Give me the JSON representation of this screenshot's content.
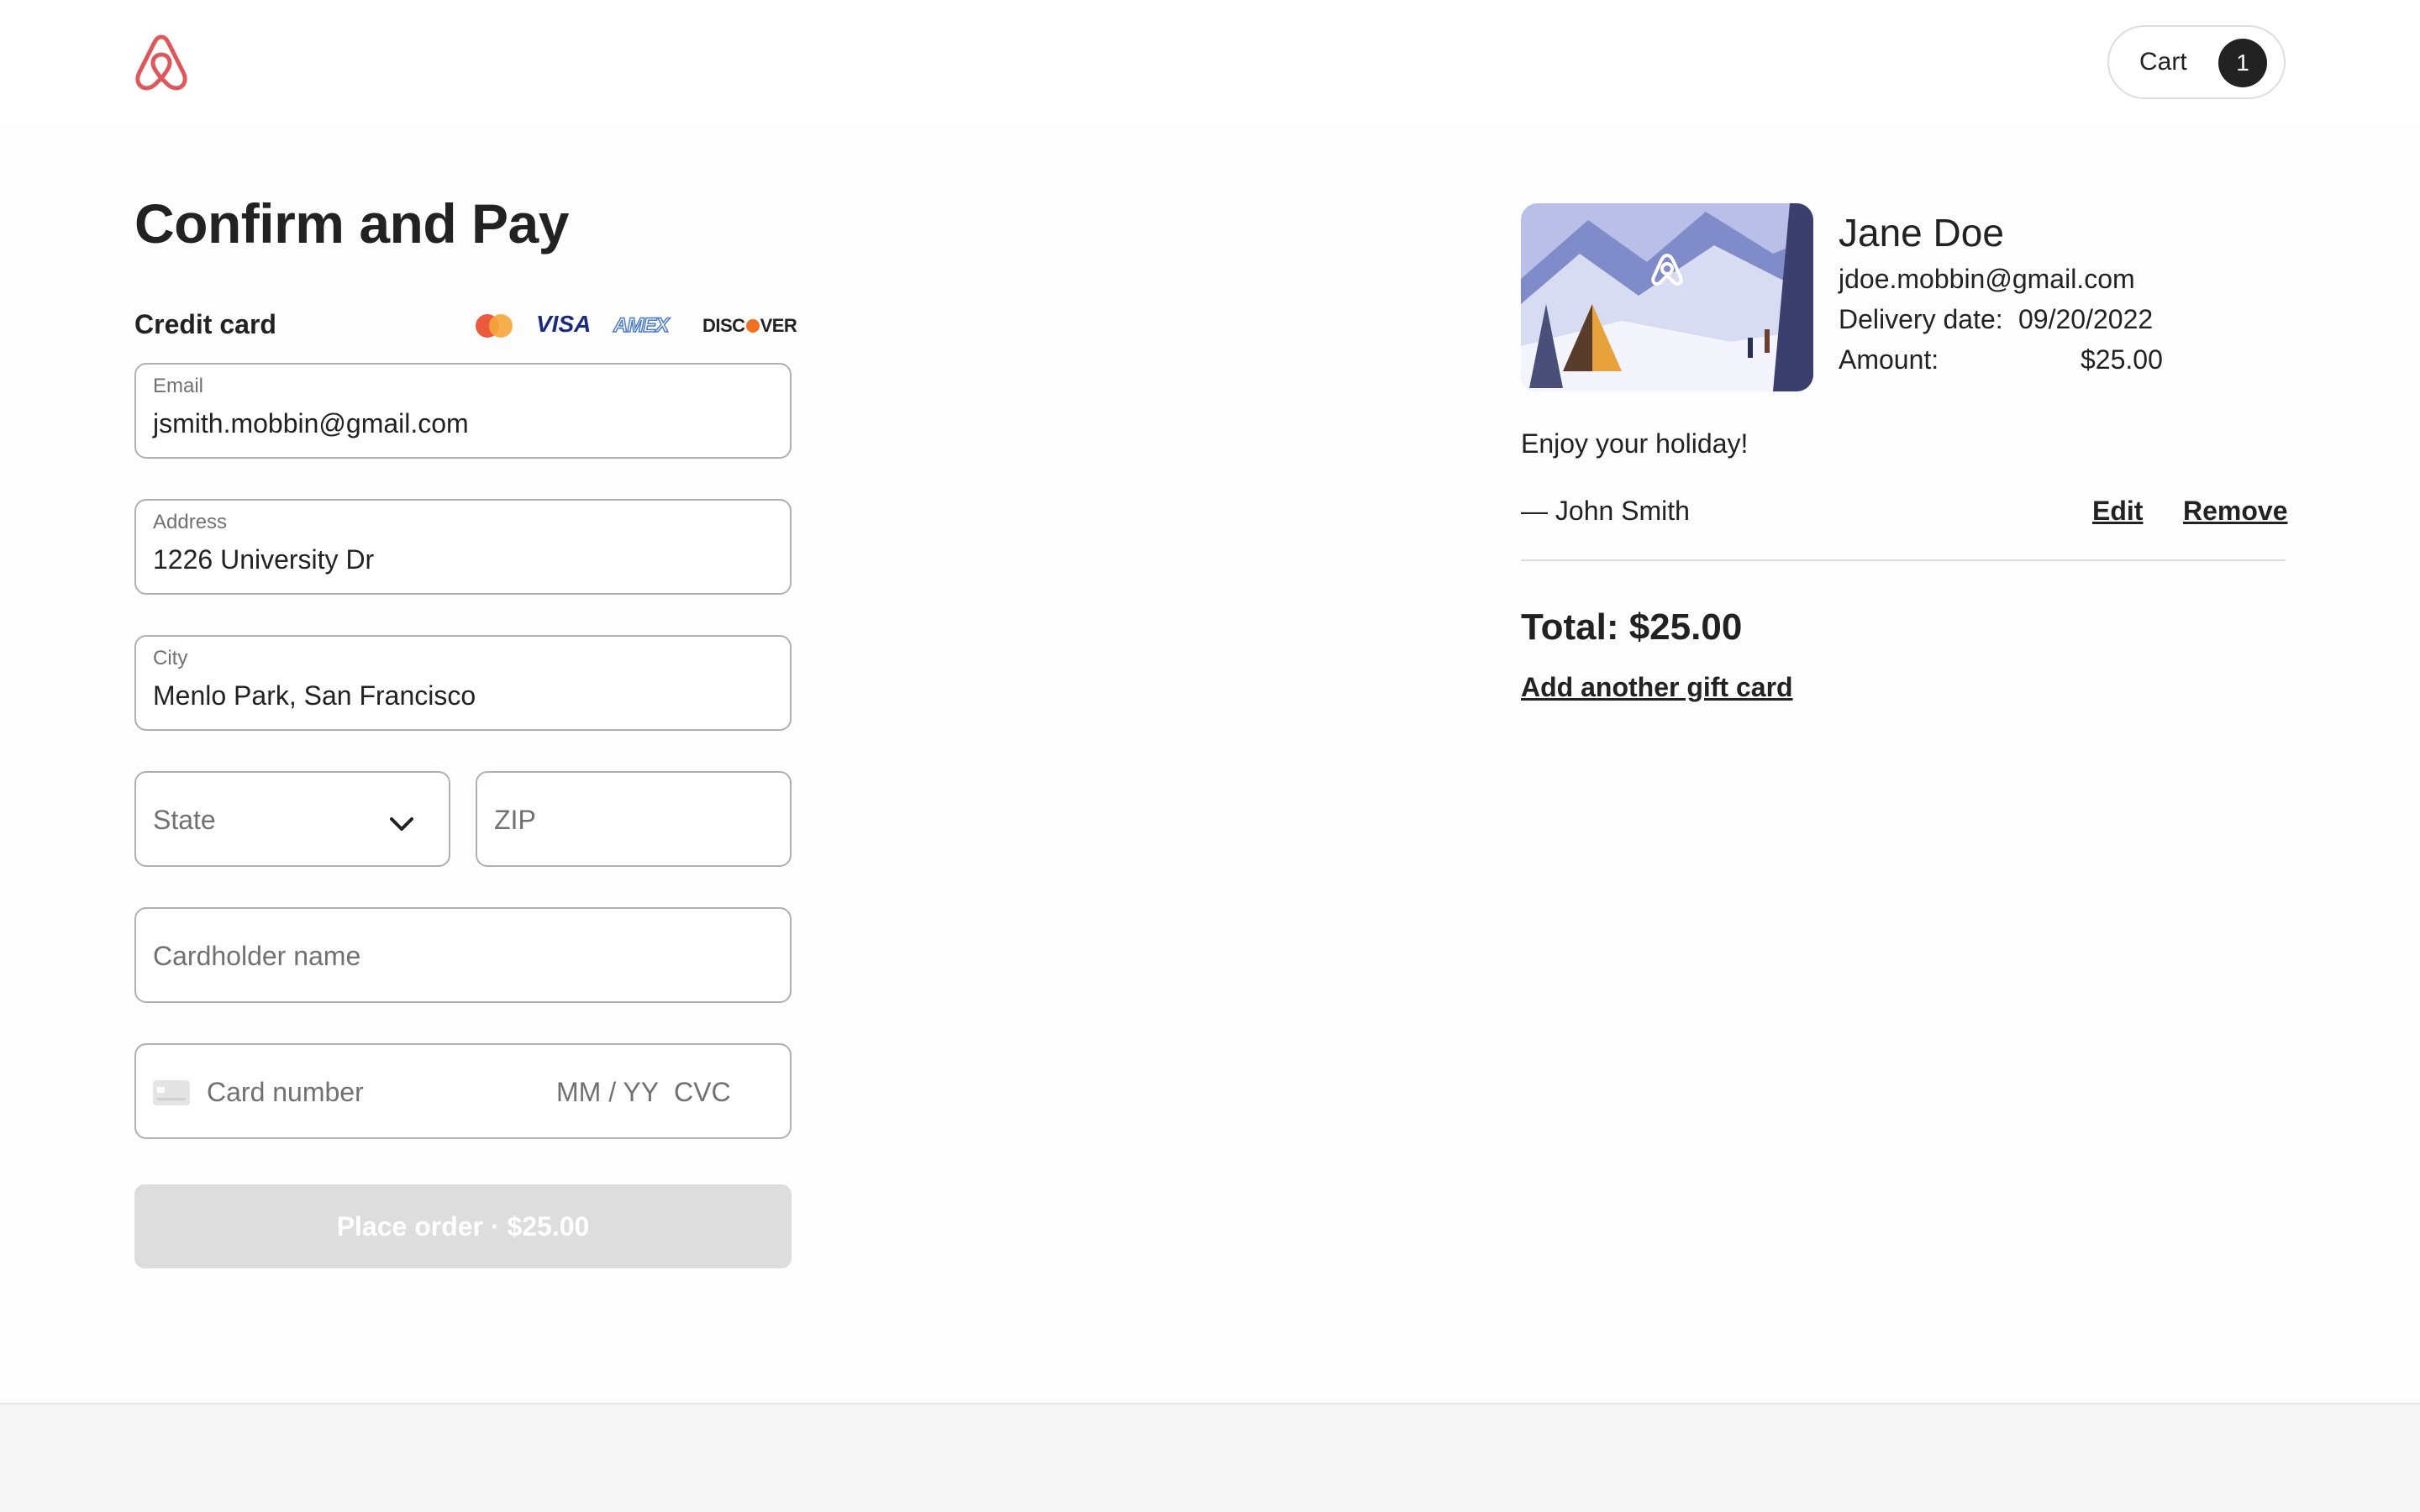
{
  "header": {
    "logo_icon": "airbnb-logo-icon",
    "brand_color": "#e0565b",
    "cart_label": "Cart",
    "cart_count": "1"
  },
  "checkout": {
    "title": "Confirm and Pay",
    "payment_method_label": "Credit card",
    "card_brands": {
      "visa": "VISA",
      "amex": "AMEX",
      "discover_pre": "DISC",
      "discover_post": "VER"
    },
    "email": {
      "label": "Email",
      "value": "jsmith.mobbin@gmail.com"
    },
    "address": {
      "label": "Address",
      "value": "1226 University Dr"
    },
    "city": {
      "label": "City",
      "value": "Menlo Park, San Francisco"
    },
    "state": {
      "placeholder": "State"
    },
    "zip": {
      "placeholder": "ZIP"
    },
    "cardholder": {
      "placeholder": "Cardholder name"
    },
    "card": {
      "number_placeholder": "Card number",
      "expiry_placeholder": "MM / YY",
      "cvc_placeholder": "CVC"
    },
    "place_order_label": "Place order · $25.00",
    "button_disabled_color": "#dddddd"
  },
  "gift_card": {
    "recipient_name": "Jane Doe",
    "recipient_email": "jdoe.mobbin@gmail.com",
    "delivery_label": "Delivery date:",
    "delivery_date": "09/20/2022",
    "amount_label": "Amount:",
    "amount_value": "$25.00",
    "message": "Enjoy your holiday!",
    "sender": "— John Smith",
    "edit_label": "Edit",
    "remove_label": "Remove"
  },
  "summary": {
    "total": "Total: $25.00",
    "add_gift_label": "Add another gift card"
  }
}
